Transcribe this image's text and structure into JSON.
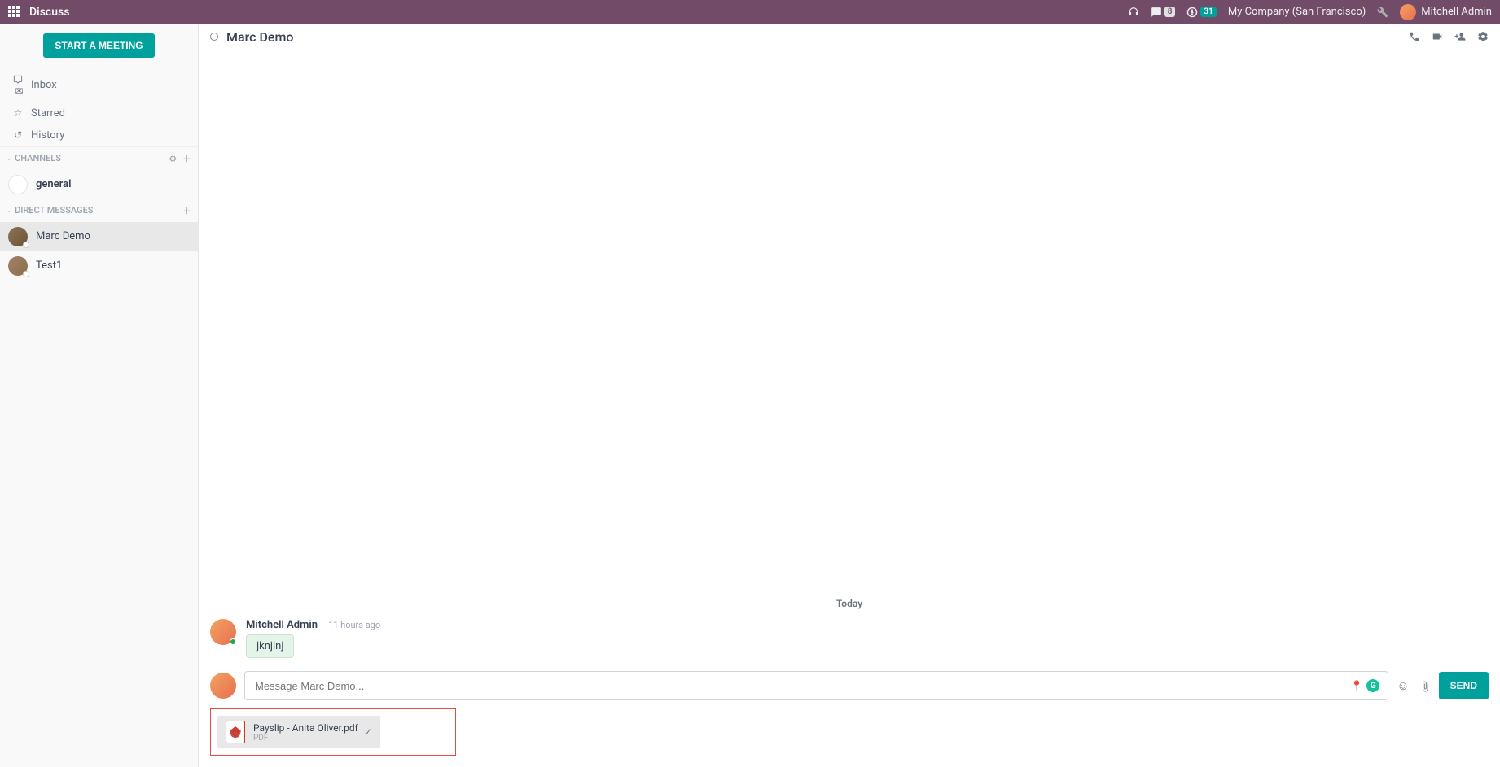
{
  "navbar": {
    "brand": "Discuss",
    "messages_badge": "8",
    "activities_badge": "31",
    "company": "My Company (San Francisco)",
    "username": "Mitchell Admin"
  },
  "sidebar": {
    "start_meeting": "START A MEETING",
    "mailboxes": [
      {
        "icon": "inbox",
        "label": "Inbox"
      },
      {
        "icon": "star",
        "label": "Starred"
      },
      {
        "icon": "history",
        "label": "History"
      }
    ],
    "channels_header": "CHANNELS",
    "channels": [
      {
        "label": "general"
      }
    ],
    "dm_header": "DIRECT MESSAGES",
    "dms": [
      {
        "label": "Marc Demo",
        "active": true
      },
      {
        "label": "Test1",
        "active": false
      }
    ]
  },
  "thread": {
    "title": "Marc Demo",
    "date_label": "Today",
    "messages": [
      {
        "author": "Mitchell Admin",
        "time": "- 11 hours ago",
        "content": "jknjlnj"
      }
    ]
  },
  "composer": {
    "placeholder": "Message Marc Demo...",
    "send_label": "SEND"
  },
  "attachment": {
    "filename": "Payslip - Anita Oliver.pdf",
    "filetype": "PDF"
  }
}
